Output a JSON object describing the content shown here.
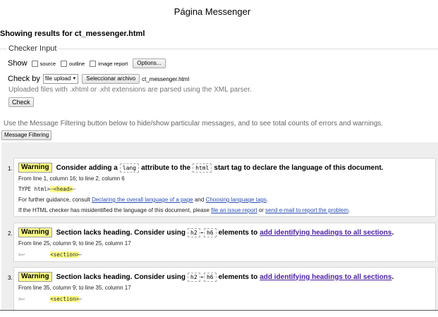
{
  "page_title": "Página Messenger",
  "results_heading": "Showing results for ct_messenger.html",
  "checker": {
    "legend": "Checker Input",
    "show_label": "Show",
    "options": [
      {
        "label": "source",
        "checked": false
      },
      {
        "label": "outline",
        "checked": false
      },
      {
        "label": "image report",
        "checked": false
      }
    ],
    "options_button": "Options...",
    "check_by_label": "Check by",
    "check_by_value": "file upload",
    "file_button": "Seleccionar archivo",
    "file_name": "ct_messenger.html",
    "hint": "Uploaded files with .xhtml or .xht extensions are parsed using the XML parser.",
    "check_button": "Check"
  },
  "filter_note": "Use the Message Filtering button below to hide/show particular messages, and to see total counts of errors and warnings.",
  "filter_button": "Message Filtering",
  "messages": [
    {
      "number": "1.",
      "type": "Warning",
      "text_a": "Consider adding a",
      "code_a": "lang",
      "text_b": "attribute to the",
      "code_b": "html",
      "text_c": "start tag to declare the language of this document.",
      "location": "From line 1, column 16; to line 2, column 6",
      "extract_pre": "TYPE html>",
      "extract_ret": "↩",
      "extract_hl": "<head>",
      "extract_post": "↩",
      "guidance_pre": "For further guidance, consult",
      "guidance_link1": "Declaring the overall language of a page",
      "guidance_mid": "and",
      "guidance_link2": "Choosing language tags",
      "guidance_end": ".",
      "misid_pre": "If the HTML checker has misidentified the language of this document, please",
      "misid_link1": "file an issue report",
      "misid_mid": "or",
      "misid_link2": "send e-mail to report the problem",
      "misid_end": "."
    },
    {
      "number": "2.",
      "type": "Warning",
      "text_a": "Section lacks heading. Consider using",
      "code_a": "h2",
      "dash": "-",
      "code_b": "h6",
      "text_b": "elements to",
      "link": "add identifying headings to all sections",
      "end": ".",
      "location": "From line 25, column 9; to line 25, column 17",
      "extract_pre": ">↩",
      "extract_hl": "<section>",
      "extract_post": "↩"
    },
    {
      "number": "3.",
      "type": "Warning",
      "text_a": "Section lacks heading. Consider using",
      "code_a": "h2",
      "dash": "-",
      "code_b": "h6",
      "text_b": "elements to",
      "link": "add identifying headings to all sections",
      "end": ".",
      "location": "From line 35, column 9; to line 35, column 17",
      "extract_pre": ">↩",
      "extract_hl": "<section>",
      "extract_post": "↩"
    }
  ]
}
